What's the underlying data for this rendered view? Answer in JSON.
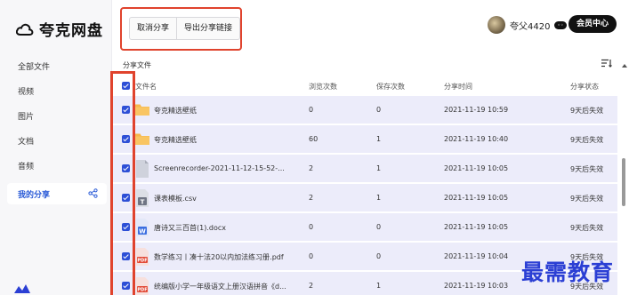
{
  "app": {
    "name": "夸克网盘"
  },
  "sidebar": {
    "items": [
      {
        "label": "全部文件"
      },
      {
        "label": "视频"
      },
      {
        "label": "图片"
      },
      {
        "label": "文档"
      },
      {
        "label": "音频"
      },
      {
        "label": "我的分享"
      }
    ],
    "active_index": 5
  },
  "toolbar": {
    "cancel_share": "取消分享",
    "export_links": "导出分享链接"
  },
  "user": {
    "name": "夸父4420",
    "member_button": "会员中心"
  },
  "section": {
    "title": "分享文件"
  },
  "table": {
    "columns": [
      "文件名",
      "浏览次数",
      "保存次数",
      "分享时间",
      "分享状态"
    ],
    "rows": [
      {
        "icon": "folder-icon",
        "name": "夸克精选壁纸",
        "views": "0",
        "saves": "0",
        "time": "2021-11-19 10:59",
        "status": "9天后失效"
      },
      {
        "icon": "folder-icon",
        "name": "夸克精选壁纸",
        "views": "60",
        "saves": "1",
        "time": "2021-11-19 10:40",
        "status": "9天后失效"
      },
      {
        "icon": "video-file-icon",
        "name": "Screenrecorder-2021-11-12-15-52-...",
        "views": "2",
        "saves": "1",
        "time": "2021-11-19 10:05",
        "status": "9天后失效"
      },
      {
        "icon": "text-file-icon",
        "name": "课表模板.csv",
        "views": "2",
        "saves": "1",
        "time": "2021-11-19 10:05",
        "status": "9天后失效"
      },
      {
        "icon": "word-file-icon",
        "name": "唐诗又三百首(1).docx",
        "views": "0",
        "saves": "0",
        "time": "2021-11-19 10:05",
        "status": "9天后失效"
      },
      {
        "icon": "pdf-file-icon",
        "name": "数学练习丨凑十法20以内加法练习册.pdf",
        "views": "0",
        "saves": "0",
        "time": "2021-11-19 10:04",
        "status": "9天后失效"
      },
      {
        "icon": "pdf-file-icon",
        "name": "统编版小学一年级语文上册汉语拼音《d...",
        "views": "2",
        "saves": "1",
        "time": "2021-11-19 10:03",
        "status": "9天后失效"
      }
    ]
  },
  "watermark": "最需教育",
  "colors": {
    "accent": "#2d4fd6",
    "highlight": "#e0432d",
    "row_selected": "#ececfa"
  }
}
